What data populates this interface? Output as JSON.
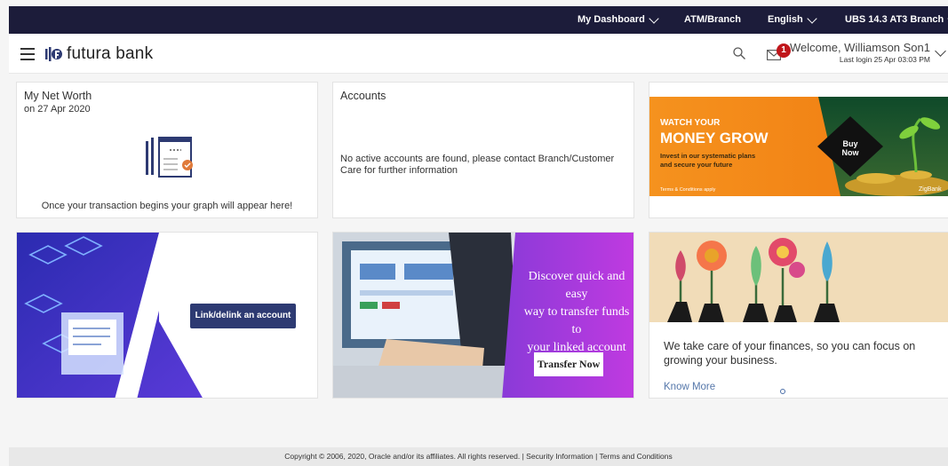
{
  "topbar": {
    "dashboard": "My Dashboard",
    "atm": "ATM/Branch",
    "language": "English",
    "entity": "UBS 14.3 AT3 Branch"
  },
  "header": {
    "brand": "futura bank",
    "notifications_count": "1",
    "welcome": "Welcome, Williamson Son1",
    "last_login": "Last login 25 Apr 03:03 PM"
  },
  "net_worth": {
    "title": "My Net Worth",
    "date": "on 27 Apr 2020",
    "empty_message": "Once your transaction begins your graph will appear here!"
  },
  "accounts": {
    "title": "Accounts",
    "empty_message": "No active accounts are found, please contact Branch/Customer Care for further information"
  },
  "banner_grow": {
    "line1": "WATCH YOUR",
    "line2": "MONEY GROW",
    "line3": "Invest in our systematic plans",
    "line4": "and secure your future",
    "terms": "Terms & Conditions apply",
    "buy_now_1": "Buy",
    "buy_now_2": "Now",
    "brand": "ZigBank"
  },
  "link_card": {
    "button": "Link/delink an account"
  },
  "transfer_card": {
    "line1": "Discover quick and easy",
    "line2": "way to transfer funds to",
    "line3": "your linked account",
    "button": "Transfer Now"
  },
  "finance_card": {
    "description": "We take care of your finances, so you can focus on growing your business.",
    "link": "Know More"
  },
  "footer": {
    "text": "Copyright © 2006, 2020, Oracle and/or its affiliates. All rights reserved. | Security Information | Terms and Conditions"
  }
}
